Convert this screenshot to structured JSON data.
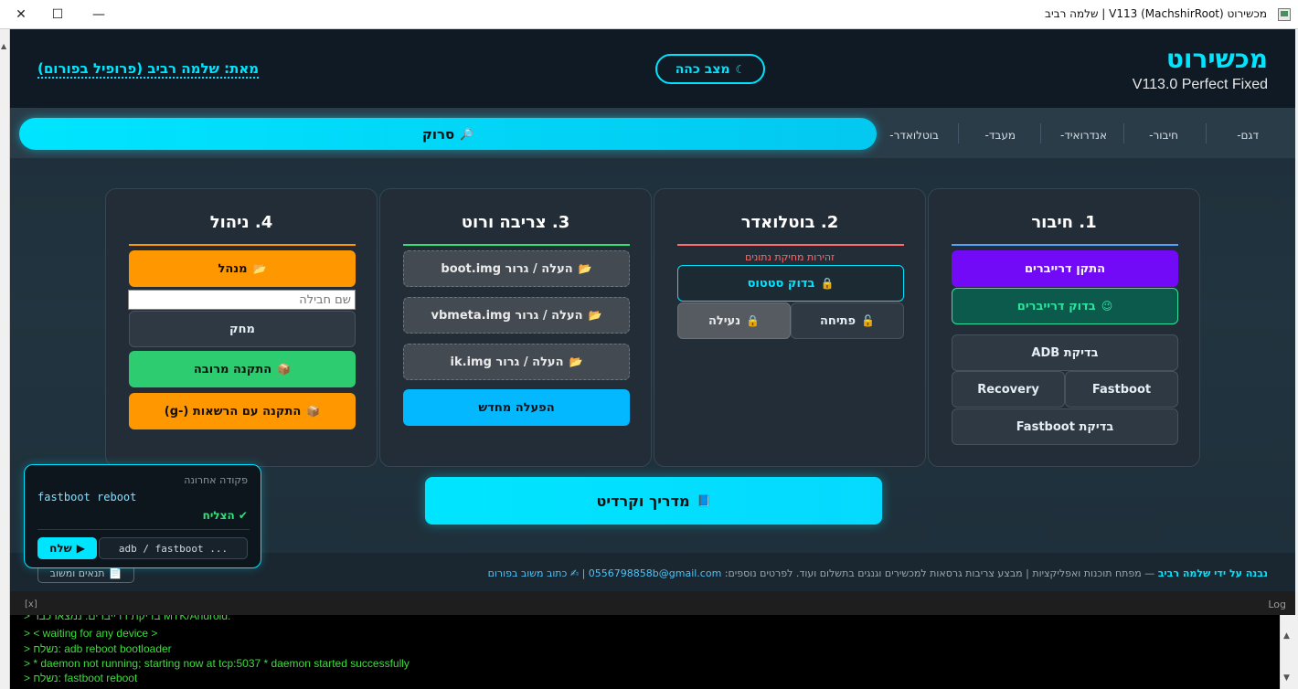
{
  "window": {
    "title": "מכשירוט V113 (MachshirRoot) | שלמה רביב",
    "close_glyph": "✕",
    "maximize_glyph": "☐",
    "minimize_glyph": "—"
  },
  "header": {
    "brand_title": "מכשירוט",
    "brand_subtitle": "V113.0 Perfect Fixed",
    "dark_mode_label": "מצב כהה",
    "dark_mode_icon": "☾",
    "author": "מאת: שלמה רביב (פרופיל בפורום)"
  },
  "nav": {
    "scan_label": "סרוק",
    "scan_icon": "🔎",
    "tabs": [
      "דגם-",
      "חיבור-",
      "אנדרואיד-",
      "מעבד-",
      "בוטלואדר-"
    ]
  },
  "cards": [
    {
      "title": "1. חיבור",
      "line_color": "#4fa3ff",
      "install_drivers": "התקן דרייברים",
      "check_drivers": "בדוק דרייברים",
      "check_drivers_icon": "😉",
      "check_adb": "בדיקת ADB",
      "fastboot": "Fastboot",
      "recovery": "Recovery",
      "check_fastboot": "בדיקת Fastboot"
    },
    {
      "title": "2. בוטלואדר",
      "line_color": "#ff6b6b",
      "warning": "זהירות מחיקת נתונים",
      "check_status": "בדוק סטטוס",
      "unlock": "פתיחה",
      "lock": "נעילה",
      "lock_icon": "🔒",
      "unlock_icon": "🔓"
    },
    {
      "title": "3. צריבה ורוט",
      "line_color": "#2ee27a",
      "folder_icon": "📂",
      "upload_boot": "העלה / גרור boot.img",
      "upload_vbmeta": "העלה / גרור vbmeta.img",
      "upload_ik": "העלה / גרור ik.img",
      "reboot": "הפעלה מחדש"
    },
    {
      "title": "4. ניהול",
      "line_color": "#ff9800",
      "manager": "מנהל",
      "manager_icon": "📂",
      "package_placeholder": "שם חבילה",
      "delete": "מחק",
      "bulk_install": "התקנה מרובה",
      "install_icon": "📦",
      "install_permissions": "התקנה עם הרשאות (-g)"
    }
  ],
  "credits": {
    "label": "מדריך וקרדיט",
    "icon": "📘"
  },
  "footer": {
    "built_by": "נבנה על ידי שלמה רביב",
    "description": " — מפתח תוכנות ואפליקציות | מבצע צריבות גרסאות למכשירים וגנגים בתשלום ועוד. לפרטים נוספים: ",
    "email": "0556798858b@gmail.com",
    "separator": " | ",
    "feedback": "✍ כתוב משוב בפורום",
    "terms": "תנאים ומשוב",
    "terms_icon": "📄"
  },
  "last_command": {
    "label": "פקודה אחרונה",
    "command": "fastboot reboot",
    "status": "✔ הצליח",
    "input_value": "adb / fastboot ...",
    "send_label": "שלח",
    "send_icon": "▶"
  },
  "log": {
    "close_label": "[x]",
    "title": "Log",
    "lines": [
      "> בדיקת דרייברים: נמצאו כבר MTK/Android.",
      "> < waiting for any device >",
      "> נשלח: adb reboot bootloader",
      "> * daemon not running; starting now at tcp:5037 * daemon started successfully",
      "> נשלח: fastboot reboot"
    ]
  },
  "colors": {
    "accent": "#00e5ff",
    "install_drivers": "#7209f7",
    "check_drivers_bg": "#0b5a4b",
    "check_drivers_border": "#2ee2a0",
    "orange": "#ff9800",
    "green": "#2ecc71",
    "reboot": "#03b8ff",
    "log_text": "#3ddc3d"
  }
}
